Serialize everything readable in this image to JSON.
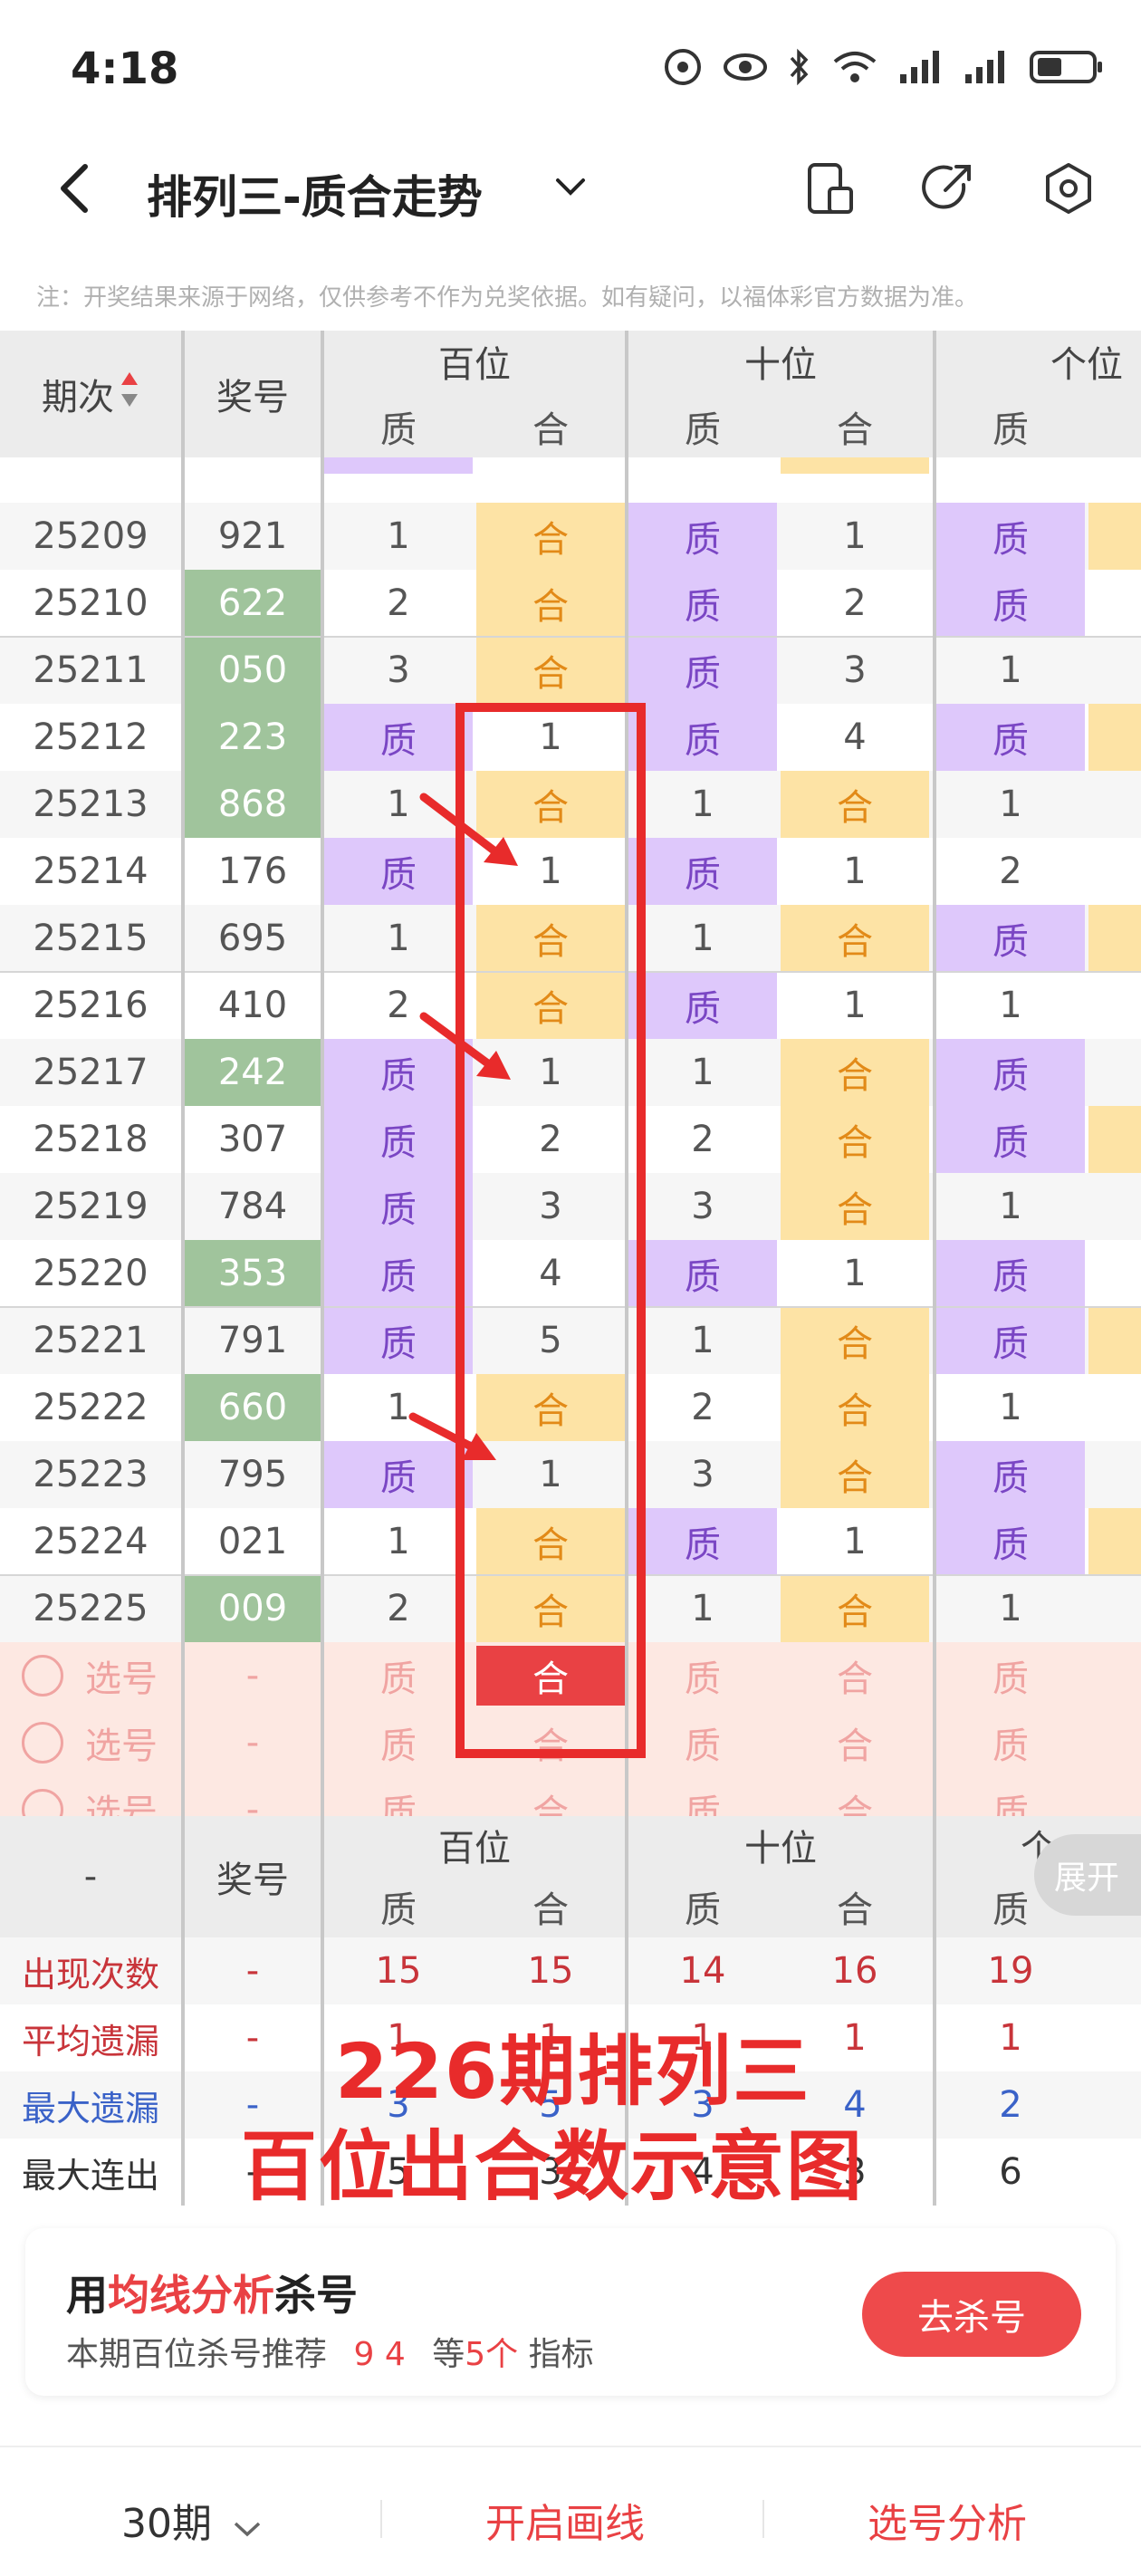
{
  "status": {
    "time": "4:18"
  },
  "appbar": {
    "title": "排列三-质合走势"
  },
  "notice": "注：开奖结果来源于网络，仅供参考不作为兑奖依据。如有疑问，以福体彩官方数据为准。",
  "header": {
    "col_period": "期次",
    "col_prize": "奖号",
    "groups": [
      "百位",
      "十位",
      "个位"
    ],
    "sub": [
      "质",
      "合",
      "质",
      "合",
      "质"
    ]
  },
  "rows": [
    {
      "period": "25209",
      "num": "921",
      "green": false,
      "c": [
        "1",
        "合",
        "质",
        "1",
        "质"
      ]
    },
    {
      "period": "25210",
      "num": "622",
      "green": true,
      "c": [
        "2",
        "合",
        "质",
        "2",
        "质"
      ]
    },
    {
      "period": "25211",
      "num": "050",
      "green": true,
      "c": [
        "3",
        "合",
        "质",
        "3",
        "1"
      ]
    },
    {
      "period": "25212",
      "num": "223",
      "green": true,
      "c": [
        "质",
        "1",
        "质",
        "4",
        "质"
      ]
    },
    {
      "period": "25213",
      "num": "868",
      "green": true,
      "c": [
        "1",
        "合",
        "1",
        "合",
        "1"
      ]
    },
    {
      "period": "25214",
      "num": "176",
      "green": false,
      "c": [
        "质",
        "1",
        "质",
        "1",
        "2"
      ]
    },
    {
      "period": "25215",
      "num": "695",
      "green": false,
      "c": [
        "1",
        "合",
        "1",
        "合",
        "质"
      ]
    },
    {
      "period": "25216",
      "num": "410",
      "green": false,
      "c": [
        "2",
        "合",
        "质",
        "1",
        "1"
      ]
    },
    {
      "period": "25217",
      "num": "242",
      "green": true,
      "c": [
        "质",
        "1",
        "1",
        "合",
        "质"
      ]
    },
    {
      "period": "25218",
      "num": "307",
      "green": false,
      "c": [
        "质",
        "2",
        "2",
        "合",
        "质"
      ]
    },
    {
      "period": "25219",
      "num": "784",
      "green": false,
      "c": [
        "质",
        "3",
        "3",
        "合",
        "1"
      ]
    },
    {
      "period": "25220",
      "num": "353",
      "green": true,
      "c": [
        "质",
        "4",
        "质",
        "1",
        "质"
      ]
    },
    {
      "period": "25221",
      "num": "791",
      "green": false,
      "c": [
        "质",
        "5",
        "1",
        "合",
        "质"
      ]
    },
    {
      "period": "25222",
      "num": "660",
      "green": true,
      "c": [
        "1",
        "合",
        "2",
        "合",
        "1"
      ]
    },
    {
      "period": "25223",
      "num": "795",
      "green": false,
      "c": [
        "质",
        "1",
        "3",
        "合",
        "质"
      ]
    },
    {
      "period": "25224",
      "num": "021",
      "green": false,
      "c": [
        "1",
        "合",
        "质",
        "1",
        "质"
      ]
    },
    {
      "period": "25225",
      "num": "009",
      "green": true,
      "c": [
        "2",
        "合",
        "1",
        "合",
        "1"
      ]
    }
  ],
  "select_rows": [
    {
      "label": "选号",
      "num": "-",
      "c": [
        "质",
        "合",
        "质",
        "合",
        "质"
      ],
      "selected": 1
    },
    {
      "label": "选号",
      "num": "-",
      "c": [
        "质",
        "合",
        "质",
        "合",
        "质"
      ],
      "selected": -1
    },
    {
      "label": "选号",
      "num": "-",
      "c": [
        "质",
        "合",
        "质",
        "合",
        "质"
      ],
      "selected": -1
    }
  ],
  "stats": {
    "left_dash": "-",
    "col_prize": "奖号",
    "groups": [
      "百位",
      "十位",
      "个"
    ],
    "sub": [
      "质",
      "合",
      "质",
      "合",
      "质"
    ],
    "expand": "展开",
    "rows": [
      {
        "label": "出现次数",
        "label_color": "#c8343a",
        "dash": "-",
        "vals": [
          "15",
          "15",
          "14",
          "16",
          "19"
        ],
        "val_color": "#c8343a"
      },
      {
        "label": "平均遗漏",
        "label_color": "#c8343a",
        "dash": "-",
        "vals": [
          "1",
          "1",
          "1",
          "1",
          "1"
        ],
        "val_color": "#c8343a"
      },
      {
        "label": "最大遗漏",
        "label_color": "#3a62c8",
        "dash": "-",
        "vals": [
          "3",
          "5",
          "3",
          "4",
          "2"
        ],
        "val_color": "#3a62c8"
      },
      {
        "label": "最大连出",
        "label_color": "#333333",
        "dash": "-",
        "vals": [
          "5",
          "3",
          "4",
          "3",
          "6"
        ],
        "val_color": "#333333"
      }
    ]
  },
  "annotation": {
    "line1": "226期排列三",
    "line2": "百位出合数示意图"
  },
  "promo": {
    "title_a": "用",
    "title_b": "均线分析",
    "title_c": "杀号",
    "sub_a": "本期百位杀号推荐",
    "sub_nums": "9 4",
    "sub_b": "等",
    "sub_count": "5个",
    "sub_c": "指标",
    "button": "去杀号"
  },
  "bottom": {
    "periods": "30期",
    "draw_line": "开启画线",
    "analysis": "选号分析"
  },
  "colors": {
    "accent_red": "#e94144",
    "purple": "#dec8fb",
    "orange": "#fde3a5",
    "green": "#a0c49c"
  }
}
